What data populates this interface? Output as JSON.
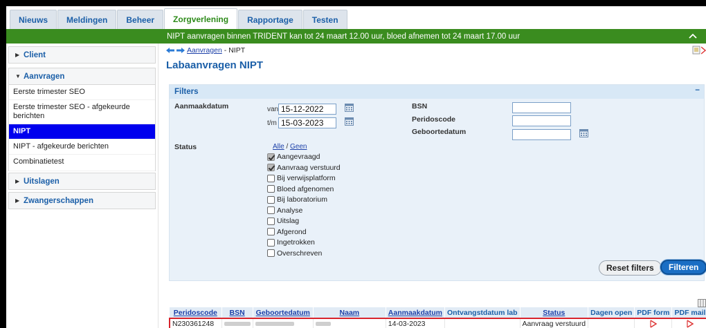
{
  "tabs": [
    {
      "label": "Nieuws"
    },
    {
      "label": "Meldingen"
    },
    {
      "label": "Beheer"
    },
    {
      "label": "Zorgverlening"
    },
    {
      "label": "Rapportage"
    },
    {
      "label": "Testen"
    }
  ],
  "active_tab": "Zorgverlening",
  "banner": "NIPT aanvragen binnen TRIDENT kan tot 24 maart 12.00 uur, bloed afnemen tot 24 maart 17.00 uur",
  "sidebar": {
    "client": "Client",
    "aanvragen": "Aanvragen",
    "items": [
      "Eerste trimester SEO",
      "Eerste trimester SEO - afgekeurde berichten",
      "NIPT",
      "NIPT - afgekeurde berichten",
      "Combinatietest"
    ],
    "uitslagen": "Uitslagen",
    "zwangerschappen": "Zwangerschappen"
  },
  "breadcrumb": {
    "link": "Aanvragen",
    "current": " - NIPT"
  },
  "page_title": "Labaanvragen NIPT",
  "filters": {
    "heading": "Filters",
    "collapse": "−",
    "aanmaakdatum_label": "Aanmaakdatum",
    "van_label": "van",
    "van_value": "15-12-2022",
    "tm_label": "t/m",
    "tm_value": "15-03-2023",
    "bsn_label": "BSN",
    "peridoscode_label": "Peridoscode",
    "geboortedatum_label": "Geboortedatum",
    "status_label": "Status",
    "alle": "Alle",
    "slash": " / ",
    "geen": "Geen",
    "statuses": [
      {
        "label": "Aangevraagd",
        "checked": true
      },
      {
        "label": "Aanvraag verstuurd",
        "checked": true
      },
      {
        "label": "Bij verwijsplatform",
        "checked": false
      },
      {
        "label": "Bloed afgenomen",
        "checked": false
      },
      {
        "label": "Bij laboratorium",
        "checked": false
      },
      {
        "label": "Analyse",
        "checked": false
      },
      {
        "label": "Uitslag",
        "checked": false
      },
      {
        "label": "Afgerond",
        "checked": false
      },
      {
        "label": "Ingetrokken",
        "checked": false
      },
      {
        "label": "Overschreven",
        "checked": false
      }
    ],
    "reset_label": "Reset filters",
    "filter_label": "Filteren"
  },
  "table": {
    "columns": [
      "Peridoscode",
      "BSN",
      "Geboortedatum",
      "Naam",
      "Aanmaakdatum",
      "Ontvangstdatum lab",
      "Status",
      "Dagen open",
      "PDF form",
      "PDF mail"
    ],
    "rows": [
      {
        "peridoscode": "N230361248",
        "aanmaakdatum": "14-03-2023",
        "status": "Aanvraag verstuurd"
      }
    ]
  },
  "colors": {
    "accent_blue": "#1b5fa8",
    "banner_green": "#3a8c1f",
    "active_nav": "#0000ee",
    "selected_row_border": "#d8242c"
  }
}
